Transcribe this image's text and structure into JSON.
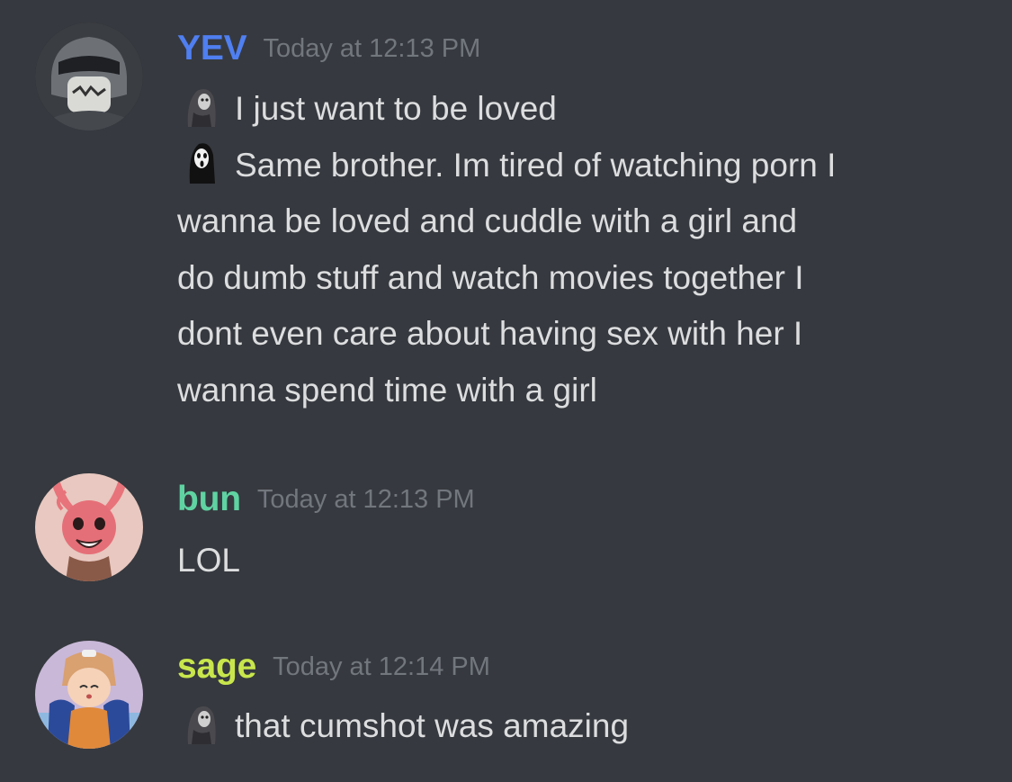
{
  "colors": {
    "background": "#36393f",
    "text": "#dcddde",
    "timestamp": "#72767d",
    "yev": "#4f7ff0",
    "bun": "#5fd3a2",
    "sage": "#c8e64c"
  },
  "messages": [
    {
      "author": "YEV",
      "author_color": "#4f7ff0",
      "timestamp": "Today at 12:13 PM",
      "avatar_icon": "masked-figure-avatar",
      "lines": [
        {
          "emoji": "ghostface-emoji",
          "text": "I just want to be loved"
        },
        {
          "emoji": "scream-mask-emoji",
          "text": "Same brother. Im tired of watching porn I"
        },
        {
          "text": "wanna be loved and cuddle with a girl and"
        },
        {
          "text": "do dumb stuff and watch movies together I"
        },
        {
          "text": "dont even care about having sex with her I"
        },
        {
          "text": "wanna spend time with a girl"
        }
      ]
    },
    {
      "author": "bun",
      "author_color": "#5fd3a2",
      "timestamp": "Today at 12:13 PM",
      "avatar_icon": "bunny-mask-avatar",
      "lines": [
        {
          "text": "LOL"
        }
      ]
    },
    {
      "author": "sage",
      "author_color": "#c8e64c",
      "timestamp": "Today at 12:14 PM",
      "avatar_icon": "anime-character-avatar",
      "lines": [
        {
          "emoji": "ghostface-emoji",
          "text": "that cumshot was amazing"
        }
      ]
    }
  ]
}
